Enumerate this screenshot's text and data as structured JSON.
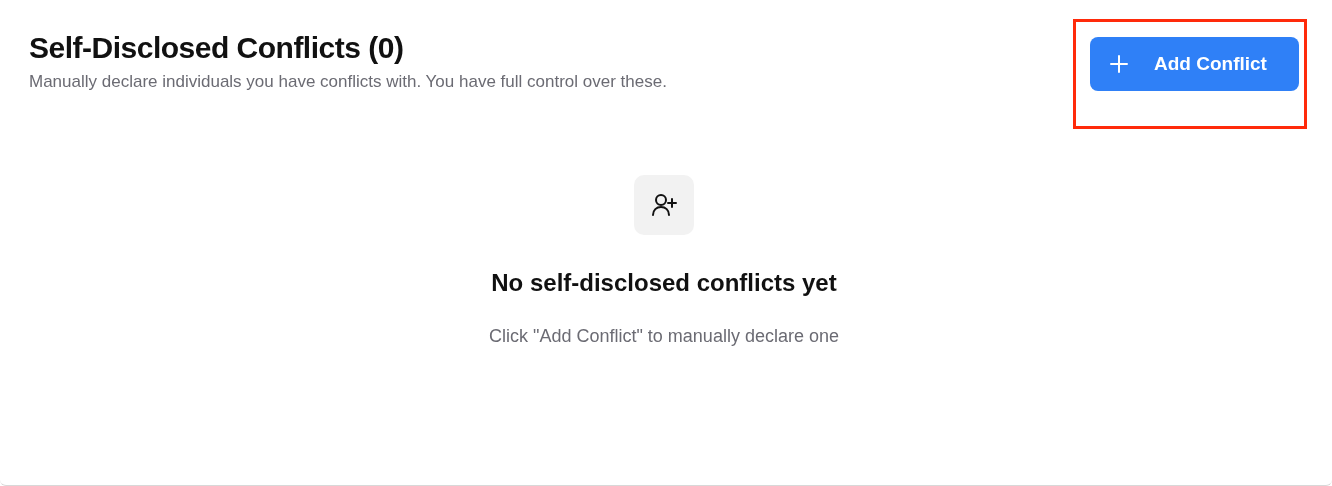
{
  "header": {
    "title": "Self-Disclosed Conflicts (0)",
    "subtitle": "Manually declare individuals you have conflicts with. You have full control over these."
  },
  "add_button": {
    "label": "Add Conflict",
    "highlighted": true
  },
  "empty_state": {
    "heading": "No self-disclosed conflicts yet",
    "hint": "Click \"Add Conflict\" to manually declare one"
  }
}
